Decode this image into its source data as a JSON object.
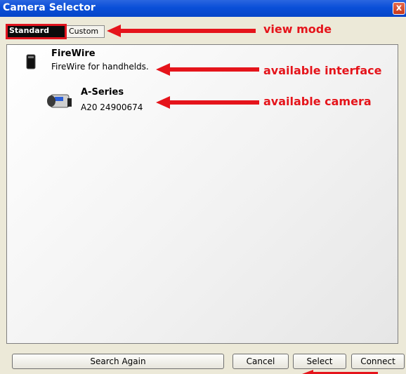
{
  "window": {
    "title": "Camera Selector",
    "close_symbol": "x"
  },
  "tabs": [
    {
      "label": "Standard",
      "active": true
    },
    {
      "label": "Custom",
      "active": false
    }
  ],
  "annotations": {
    "view_mode": "view mode",
    "available_interface": "available interface",
    "available_camera": "available camera"
  },
  "tree": {
    "interface": {
      "name": "FireWire",
      "description": "FireWire for handhelds.",
      "icon": "firewire-device-icon"
    },
    "camera": {
      "name": "A-Series",
      "description": "A20 24900674",
      "icon": "camera-icon"
    }
  },
  "buttons": {
    "search_again": "Search Again",
    "cancel": "Cancel",
    "select": "Select",
    "connect": "Connect"
  },
  "colors": {
    "titlebar": "#0a4fd8",
    "annotation": "#e5141b",
    "frame": "#ece9d8"
  }
}
